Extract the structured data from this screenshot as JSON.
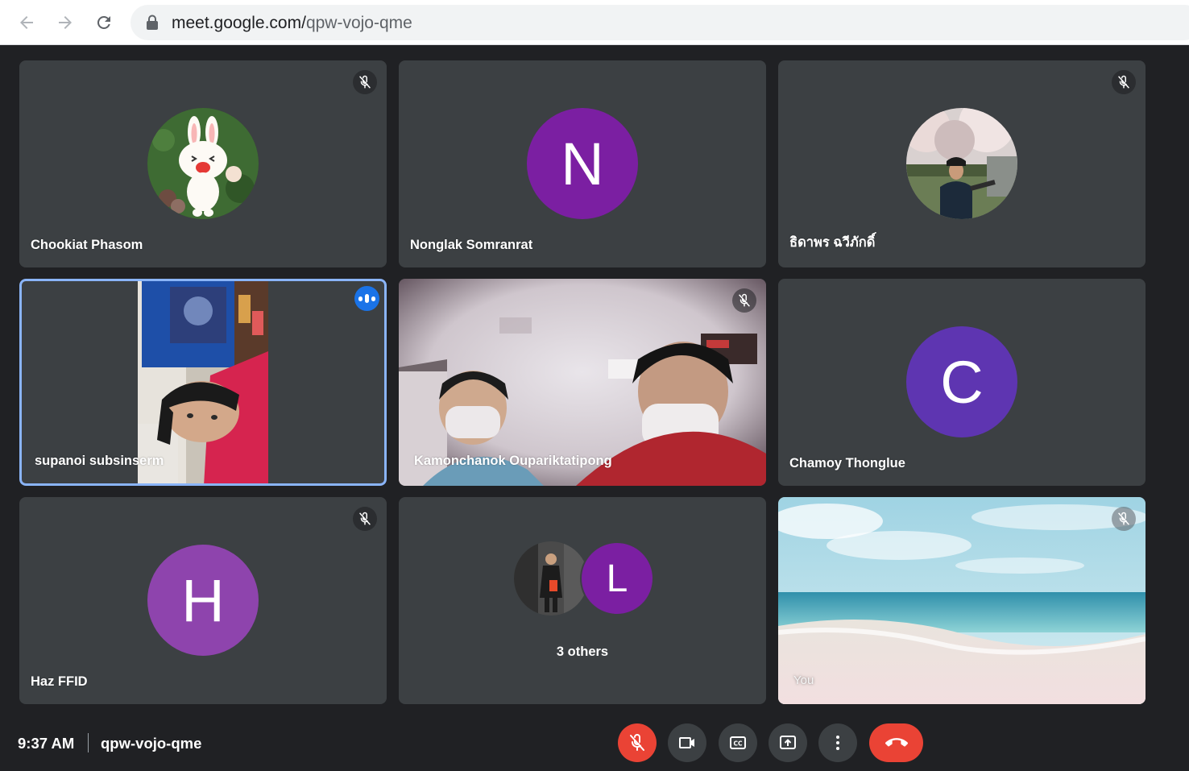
{
  "browser": {
    "url_host": "meet.google.com/",
    "url_path": "qpw-vojo-qme"
  },
  "tiles": [
    {
      "name": "Chookiat Phasom",
      "avatar": "line-bunny-photo",
      "muted": true
    },
    {
      "name": "Nonglak Somranrat",
      "avatar_letter": "N",
      "avatar_color": "#7b1fa2",
      "muted": false
    },
    {
      "name": "ธิดาพร ฉวีภักดิ์",
      "avatar": "cherry-blossom-photo",
      "muted": true
    },
    {
      "name": "supanoi subsinserm",
      "video": true,
      "speaking": true
    },
    {
      "name": "Kamonchanok Oupariktatipong",
      "video": true,
      "muted": true
    },
    {
      "name": "Chamoy Thonglue",
      "avatar_letter": "C",
      "avatar_color": "#5e35b1",
      "muted": false
    },
    {
      "name": "Haz FFID",
      "avatar_letter": "H",
      "avatar_color": "#8e44ad",
      "muted": true
    },
    {
      "others_label": "3 others",
      "avatar_letter": "L",
      "avatar_color": "#7b1fa2"
    },
    {
      "name": "You",
      "video": true,
      "background": "beach",
      "muted": true
    }
  ],
  "footer": {
    "time": "9:37 AM",
    "meeting_code": "qpw-vojo-qme"
  },
  "controls": [
    "microphone-off-icon",
    "camera-icon",
    "captions-icon",
    "present-screen-icon",
    "more-options-icon",
    "leave-call-icon"
  ],
  "colors": {
    "tile_bg": "#3c4043",
    "page_bg": "#202124",
    "active_speaker": "#8ab4f8",
    "leave": "#ea4335"
  }
}
